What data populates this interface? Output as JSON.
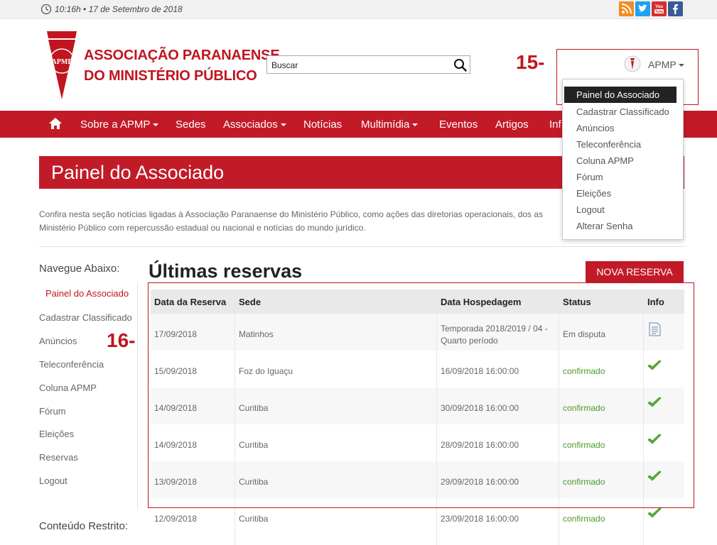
{
  "topbar": {
    "datetime": "10:16h • 17 de Setembro de 2018",
    "social": [
      {
        "icon": "rss-icon",
        "color": "#f28c1e",
        "glyph": "◉"
      },
      {
        "icon": "twitter-icon",
        "color": "#1da1f2",
        "glyph": "t"
      },
      {
        "icon": "youtube-icon",
        "color": "#d62e2e",
        "glyph": "You"
      },
      {
        "icon": "facebook-icon",
        "color": "#3b5998",
        "glyph": "f"
      }
    ]
  },
  "header": {
    "logo_line1": "ASSOCIAÇÃO PARANAENSE",
    "logo_line2": "DO MINISTÉRIO PÚBLICO",
    "search_placeholder": "Buscar",
    "annotation_user": "15-",
    "user_name": "APMP"
  },
  "nav": {
    "items": [
      {
        "label": "Sobre a APMP",
        "dropdown": true
      },
      {
        "label": "Sedes",
        "dropdown": false
      },
      {
        "label": "Associados",
        "dropdown": true
      },
      {
        "label": "Notícias",
        "dropdown": false
      },
      {
        "label": "Multimídia",
        "dropdown": true
      },
      {
        "label": "Eventos",
        "dropdown": false
      },
      {
        "label": "Artigos",
        "dropdown": false
      },
      {
        "label": "Inf",
        "dropdown": false
      }
    ]
  },
  "user_menu": {
    "items": [
      "Painel do Associado",
      "Cadastrar Classificado",
      "Anúncios",
      "Teleconferência",
      "Coluna APMP",
      "Fórum",
      "Eleições",
      "Logout",
      "Alterar Senha"
    ],
    "active_index": 0
  },
  "page": {
    "title": "Painel do Associado",
    "intro_line1": "Confira nesta seção notícias ligadas à Associação Paranaense do Ministério Público, como ações das diretorias operacionais, dos as",
    "intro_line2": "Ministério Público com repercussão estadual ou nacional e notícias do mundo jurídico."
  },
  "sidebar": {
    "heading": "Navegue Abaixo:",
    "items": [
      "Painel do Associado",
      "Cadastrar Classificado",
      "Anúncios",
      "Teleconferência",
      "Coluna APMP",
      "Fórum",
      "Eleições",
      "Reservas",
      "Logout"
    ],
    "active_index": 0,
    "restricted_heading": "Conteúdo Restrito:"
  },
  "main": {
    "title": "Últimas reservas",
    "new_button": "NOVA RESERVA",
    "annotation_table": "16-",
    "columns": [
      "Data da Reserva",
      "Sede",
      "Data Hospedagem",
      "Status",
      "Info"
    ],
    "rows": [
      {
        "date": "17/09/2018",
        "sede": "Matinhos",
        "stay_line1": "Temporada 2018/2019 / 04 -",
        "stay_line2": "Quarto período",
        "status": "Em disputa",
        "info": "document-icon"
      },
      {
        "date": "15/09/2018",
        "sede": "Foz do Iguaçu",
        "stay_line1": "16/09/2018 16:00:00",
        "stay_line2": "",
        "status": "confirmado",
        "info": "check-icon"
      },
      {
        "date": "14/09/2018",
        "sede": "Curitiba",
        "stay_line1": "30/09/2018 16:00:00",
        "stay_line2": "",
        "status": "confirmado",
        "info": "check-icon"
      },
      {
        "date": "14/09/2018",
        "sede": "Curitiba",
        "stay_line1": "28/09/2018 16:00:00",
        "stay_line2": "",
        "status": "confirmado",
        "info": "check-icon"
      },
      {
        "date": "13/09/2018",
        "sede": "Curitiba",
        "stay_line1": "29/09/2018 16:00:00",
        "stay_line2": "",
        "status": "confirmado",
        "info": "check-icon"
      },
      {
        "date": "12/09/2018",
        "sede": "Curitiba",
        "stay_line1": "23/09/2018 16:00:00",
        "stay_line2": "",
        "status": "confirmado",
        "info": "check-icon"
      }
    ]
  },
  "colors": {
    "brand_red": "#c21b28",
    "annotation_red": "#c0151f",
    "confirmed_green": "#4b9a2c"
  }
}
